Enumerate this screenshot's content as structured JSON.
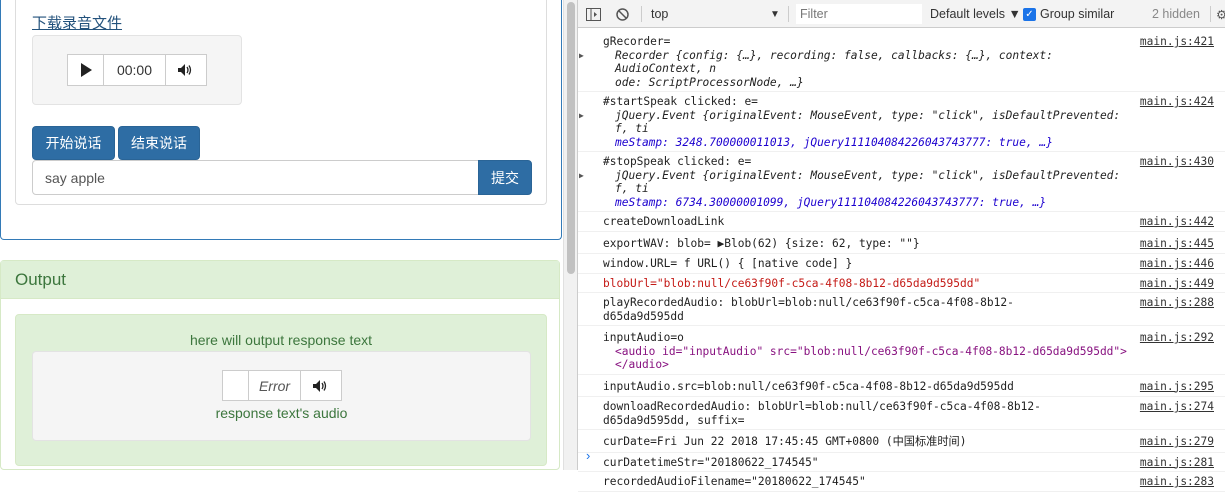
{
  "page": {
    "download_link": "下载录音文件",
    "player1": {
      "time": "00:00"
    },
    "buttons": {
      "start": "开始说话",
      "stop": "结束说话",
      "submit": "提交"
    },
    "input_value": "say apple",
    "output": {
      "heading": "Output",
      "response_text": "here will output response text",
      "player_error": "Error",
      "audio_label": "response text's audio"
    }
  },
  "devtools": {
    "toolbar": {
      "context": "top",
      "filter_placeholder": "Filter",
      "levels": "Default levels ▼",
      "group_similar": "Group similar",
      "hidden": "2 hidden"
    },
    "logs": [
      {
        "src": "main.js:421",
        "line1": "gRecorder=",
        "line2": "Recorder {config: {…}, recording: false, callbacks: {…}, context: AudioContext, n",
        "line3": "ode: ScriptProcessorNode, …}"
      },
      {
        "src": "main.js:424",
        "line1": "#startSpeak clicked: e=",
        "line2": "jQuery.Event {originalEvent: MouseEvent, type: \"click\", isDefaultPrevented: f, ti",
        "line3": "meStamp: 3248.700000011013, jQuery111104084226043743777: true, …}"
      },
      {
        "src": "main.js:430",
        "line1": "#stopSpeak clicked: e=",
        "line2": "jQuery.Event {originalEvent: MouseEvent, type: \"click\", isDefaultPrevented: f, ti",
        "line3": "meStamp: 6734.30000001099, jQuery111104084226043743777: true, …}"
      },
      {
        "src": "main.js:442",
        "line1": "createDownloadLink"
      },
      {
        "src": "main.js:445",
        "line1": "exportWAV: blob= ▶Blob(62) {size: 62, type: \"\"}"
      },
      {
        "src": "main.js:446",
        "line1": "window.URL= f URL() { [native code] }"
      },
      {
        "src": "main.js:449",
        "line1": "blobUrl=\"blob:null/ce63f90f-c5ca-4f08-8b12-d65da9d595dd\""
      },
      {
        "src": "main.js:288",
        "line1": "playRecordedAudio: blobUrl=blob:null/ce63f90f-c5ca-4f08-8b12-",
        "line2": "d65da9d595dd"
      },
      {
        "src": "main.js:292",
        "line1": "inputAudio=o",
        "line2": "<audio id=\"inputAudio\" src=\"blob:null/ce63f90f-c5ca-4f08-8b12-d65da9d595dd\">",
        "line3": "</audio>"
      },
      {
        "src": "main.js:295",
        "line1": "inputAudio.src=blob:null/ce63f90f-c5ca-4f08-8b12-d65da9d595dd"
      },
      {
        "src": "main.js:274",
        "line1": "downloadRecordedAudio: blobUrl=blob:null/ce63f90f-c5ca-4f08-8b12-",
        "line2": "d65da9d595dd, suffix="
      },
      {
        "src": "main.js:279",
        "line1": "curDate=Fri Jun 22 2018 17:45:45 GMT+0800 (中国标准时间)"
      },
      {
        "src": "main.js:281",
        "line1": "curDatetimeStr=\"20180622_174545\""
      },
      {
        "src": "main.js:283",
        "line1": "recordedAudioFilename=\"20180622_174545\""
      }
    ],
    "prompt": "›"
  }
}
